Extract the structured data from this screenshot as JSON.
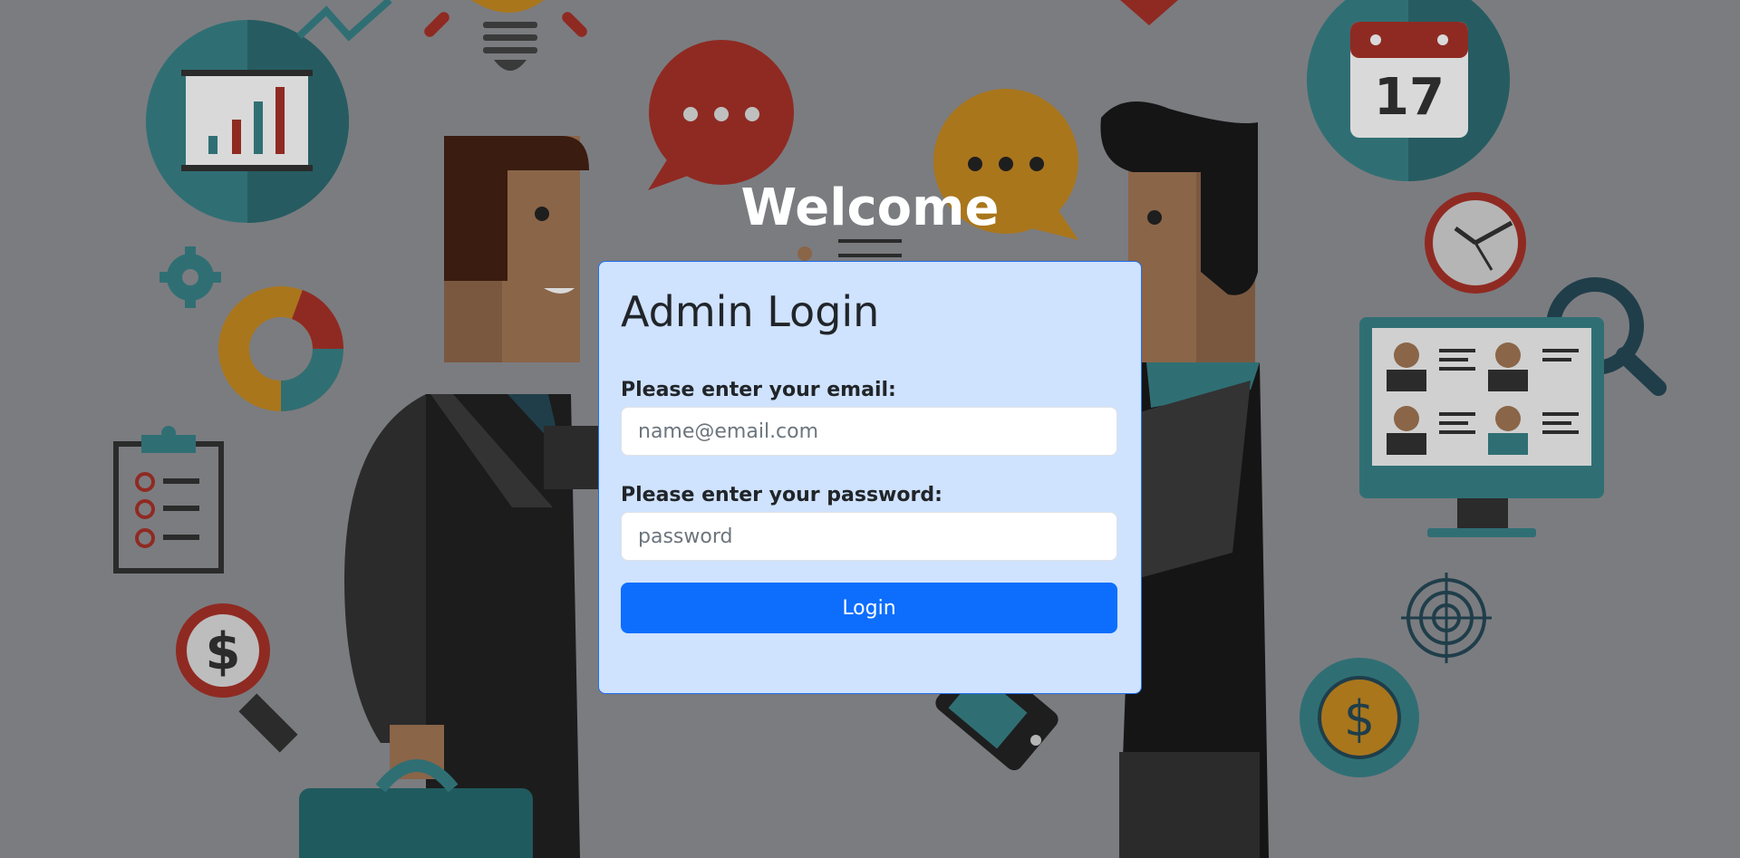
{
  "page": {
    "welcome": "Welcome",
    "calendar_day": "17",
    "currency_symbol": "$"
  },
  "login": {
    "title": "Admin Login",
    "email_label": "Please enter your email:",
    "email_placeholder": "name@email.com",
    "email_value": "",
    "password_label": "Please enter your password:",
    "password_placeholder": "password",
    "password_value": "",
    "submit_label": "Login"
  },
  "colors": {
    "background": "#7b7c80",
    "card_background": "#cfe2fe",
    "card_border": "#1f6feb",
    "button": "#0d6efd",
    "illustration_teal": "#2f6f74",
    "illustration_red": "#8f2a22",
    "illustration_gold": "#a9761c"
  },
  "icons": [
    "chart-icon",
    "lightbulb-icon",
    "speech-bubble-icon",
    "calendar-icon",
    "clock-icon",
    "magnifier-icon",
    "gear-icon",
    "donut-chart-icon",
    "clipboard-icon",
    "dollar-icon",
    "target-icon",
    "monitor-icon"
  ]
}
